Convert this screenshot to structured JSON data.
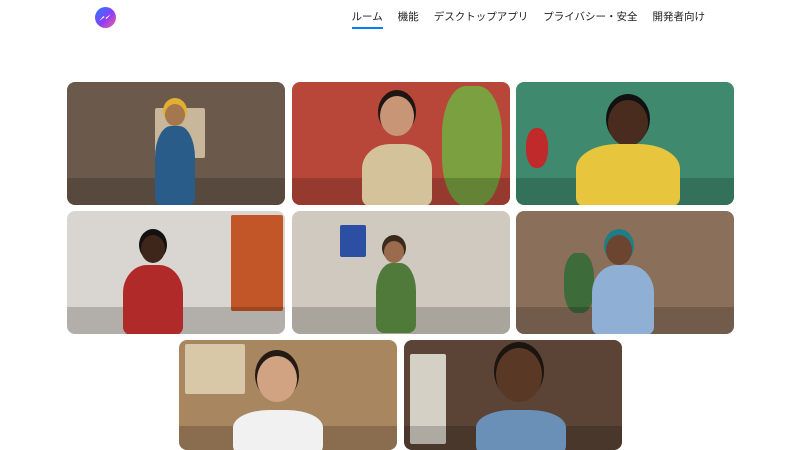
{
  "header": {
    "logo_icon": "messenger-logo-icon",
    "nav": [
      {
        "label": "ルーム",
        "active": true
      },
      {
        "label": "機能",
        "active": false
      },
      {
        "label": "デスクトップアプリ",
        "active": false
      },
      {
        "label": "プライバシー・安全",
        "active": false
      },
      {
        "label": "開発者向け",
        "active": false
      }
    ]
  },
  "tiles": [
    {
      "name": "video-tile-1",
      "bg": "#6b5a4c",
      "accent": "#c9b79b",
      "skin": "#a5774f",
      "shirt": "#2a5c8a",
      "hair": "#e2b030"
    },
    {
      "name": "video-tile-2",
      "bg": "#b8473a",
      "accent": "#7aa040",
      "skin": "#c99577",
      "shirt": "#d4c29a",
      "hair": "#1e1612"
    },
    {
      "name": "video-tile-3",
      "bg": "#3f8a6e",
      "accent": "#c02a2a",
      "skin": "#4a2c1e",
      "shirt": "#e7c63e",
      "hair": "#111111"
    },
    {
      "name": "video-tile-4",
      "bg": "#d9d6d1",
      "accent": "#c35628",
      "skin": "#3e261b",
      "shirt": "#b02a2a",
      "hair": "#151010"
    },
    {
      "name": "video-tile-5",
      "bg": "#cfc9bf",
      "accent": "#2c4fa3",
      "skin": "#9a6b4c",
      "shirt": "#4f7a3a",
      "hair": "#3b2a1c"
    },
    {
      "name": "video-tile-6",
      "bg": "#8a6f5b",
      "accent": "#3d6b3a",
      "skin": "#6b452f",
      "shirt": "#8fb0d4",
      "hair": "#1f7d86"
    },
    {
      "name": "video-tile-7",
      "bg": "#a88660",
      "accent": "#d8c8a8",
      "skin": "#d2a383",
      "shirt": "#f1f1f1",
      "hair": "#241a14"
    },
    {
      "name": "video-tile-8",
      "bg": "#5b4435",
      "accent": "#d5d0c6",
      "skin": "#5a3826",
      "shirt": "#6a90b8",
      "hair": "#1b1410"
    }
  ]
}
